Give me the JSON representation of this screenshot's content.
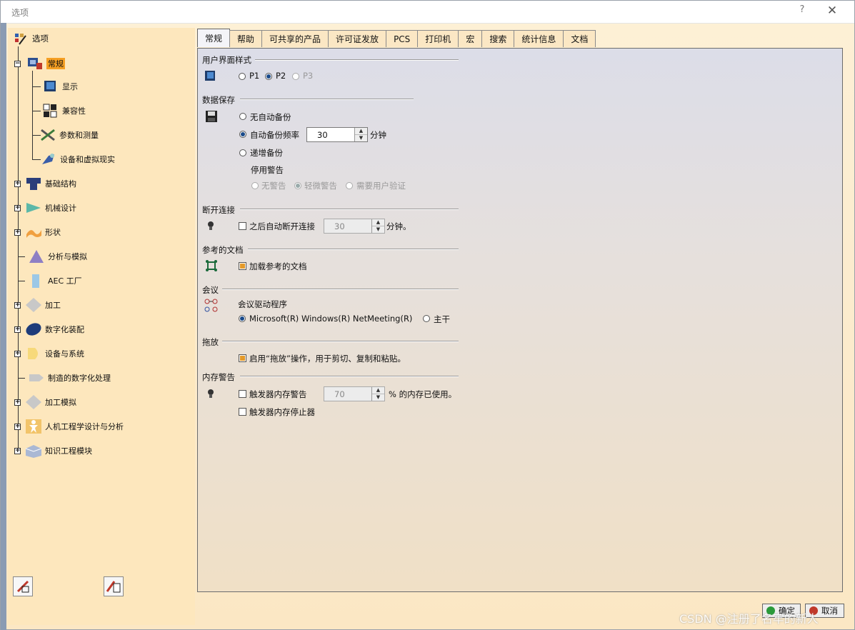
{
  "window": {
    "title": "选项",
    "help": "?",
    "close": "✕"
  },
  "tree": {
    "root": "选项",
    "items": [
      {
        "label": "常规",
        "selected": true
      },
      {
        "label": "显示"
      },
      {
        "label": "兼容性"
      },
      {
        "label": "参数和测量"
      },
      {
        "label": "设备和虚拟现实"
      },
      {
        "label": "基础结构"
      },
      {
        "label": "机械设计"
      },
      {
        "label": "形状"
      },
      {
        "label": "分析与模拟"
      },
      {
        "label": "AEC 工厂"
      },
      {
        "label": "加工"
      },
      {
        "label": "数字化装配"
      },
      {
        "label": "设备与系统"
      },
      {
        "label": "制造的数字化处理"
      },
      {
        "label": "加工模拟"
      },
      {
        "label": "人机工程学设计与分析"
      },
      {
        "label": "知识工程模块"
      }
    ]
  },
  "tabs": [
    "常规",
    "帮助",
    "可共享的产品",
    "许可证发放",
    "PCS",
    "打印机",
    "宏",
    "搜索",
    "统计信息",
    "文档"
  ],
  "sections": {
    "ui_style": {
      "title": "用户界面样式",
      "options": [
        "P1",
        "P2",
        "P3"
      ],
      "selected": "P2"
    },
    "data_save": {
      "title": "数据保存",
      "no_backup": "无自动备份",
      "auto_backup": "自动备份频率",
      "auto_value": "30",
      "auto_unit": "分钟",
      "incremental": "递增备份",
      "disable_warning": "停用警告",
      "warn_options": [
        "无警告",
        "轻微警告",
        "需要用户验证"
      ]
    },
    "disconnect": {
      "title": "断开连接",
      "label": "之后自动断开连接",
      "value": "30",
      "unit": "分钟。"
    },
    "referenced_docs": {
      "title": "参考的文档",
      "label": "加载参考的文档"
    },
    "conference": {
      "title": "会议",
      "driver": "会议驱动程序",
      "option1": "Microsoft(R) Windows(R) NetMeeting(R)",
      "option2": "主干"
    },
    "drag_drop": {
      "title": "拖放",
      "label": "启用“拖放”操作，用于剪切、复制和粘贴。"
    },
    "memory": {
      "title": "内存警告",
      "trigger": "触发器内存警告",
      "value": "70",
      "unit": "% 的内存已使用。",
      "stop": "触发器内存停止器"
    }
  },
  "buttons": {
    "ok": "确定",
    "cancel": "取消"
  },
  "watermark": "CSDN @注册了名牢的新人"
}
